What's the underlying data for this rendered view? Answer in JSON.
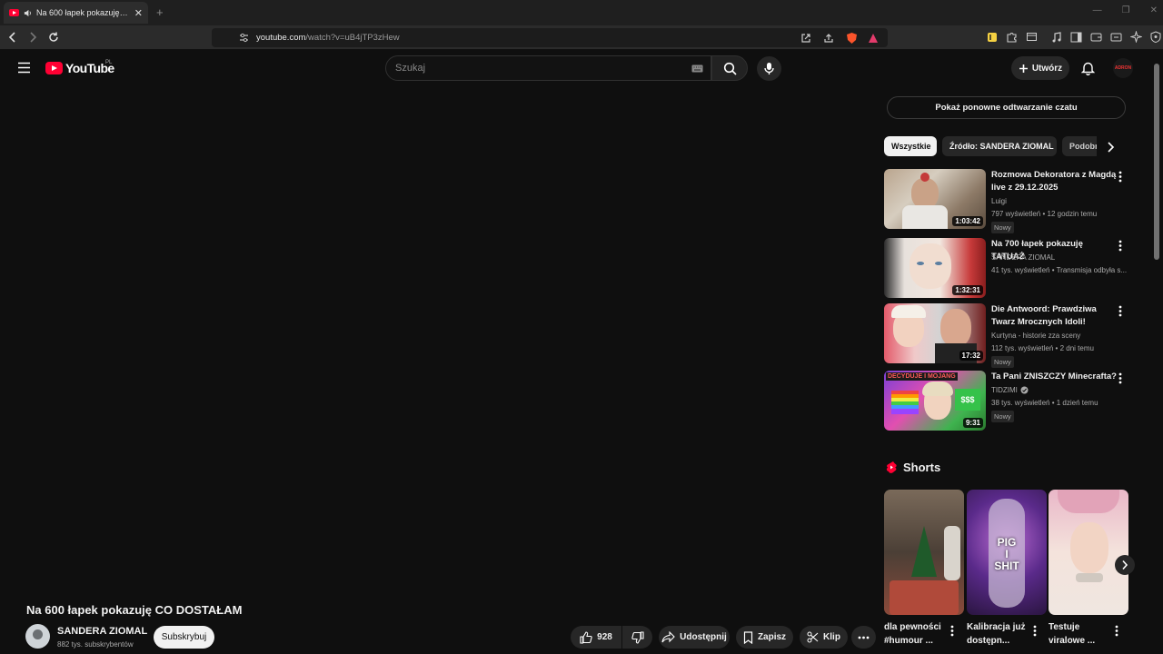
{
  "browser": {
    "tab_title": "Na 600 łapek pokazuję CO DOSTAŁAM",
    "url_host": "youtube.com",
    "url_path": "/watch?v=uB4jTP3zHew"
  },
  "header": {
    "logo_text": "YouTube",
    "country_code": "PL",
    "search_placeholder": "Szukaj",
    "create_label": "Utwórz",
    "avatar_text": "ADRON"
  },
  "video": {
    "title": "Na 600 łapek pokazuję CO DOSTAŁAM",
    "channel": "SANDERA ZIOMAL",
    "subscribers": "882 tys. subskrybentów",
    "subscribe_label": "Subskrybuj",
    "like_count": "928",
    "share_label": "Udostępnij",
    "save_label": "Zapisz",
    "clip_label": "Klip"
  },
  "sidebar": {
    "chat_replay_label": "Pokaż ponowne odtwarzanie czatu",
    "chips": [
      "Wszystkie",
      "Źródło: SANDERA ZIOMAL",
      "Podobne"
    ],
    "recommendations": [
      {
        "title": "Rozmowa Dekoratora z Magdą live z 29.12.2025",
        "channel": "Luigi",
        "meta": "797 wyświetleń • 12 godzin temu",
        "badge": "Nowy",
        "duration": "1:03:42"
      },
      {
        "title": "Na 700 łapek pokazuję TATUAŻ",
        "channel": "SANDERA ZIOMAL",
        "meta": "41 tys. wyświetleń • Transmisja odbyła s...",
        "badge": "",
        "duration": "1:32:31"
      },
      {
        "title": "Die Antwoord: Prawdziwa Twarz Mrocznych Idoli!",
        "channel": "Kurtyna - historie zza sceny",
        "meta": "112 tys. wyświetleń • 2 dni temu",
        "badge": "Nowy",
        "duration": "17:32"
      },
      {
        "title": "Ta Pani ZNISZCZY Minecrafta?",
        "channel": "TIDZIMI",
        "meta": "38 tys. wyświetleń • 1 dzień temu",
        "badge": "Nowy",
        "duration": "9:31"
      }
    ],
    "shorts_heading": "Shorts",
    "shorts": [
      {
        "title": "dla pewności #humour ..."
      },
      {
        "title": "Kalibracja już dostępn..."
      },
      {
        "title": "Testuje viralowe ..."
      }
    ],
    "short2_overlay": [
      "PIG",
      "I",
      "SHIT"
    ],
    "thumb4_overlay": "DECYDUJE I MOJANG"
  },
  "colors": {
    "background": "#0f0f0f",
    "brand_red": "#ff0033",
    "surface": "#272727",
    "secondary_text": "#aaaaaa"
  }
}
